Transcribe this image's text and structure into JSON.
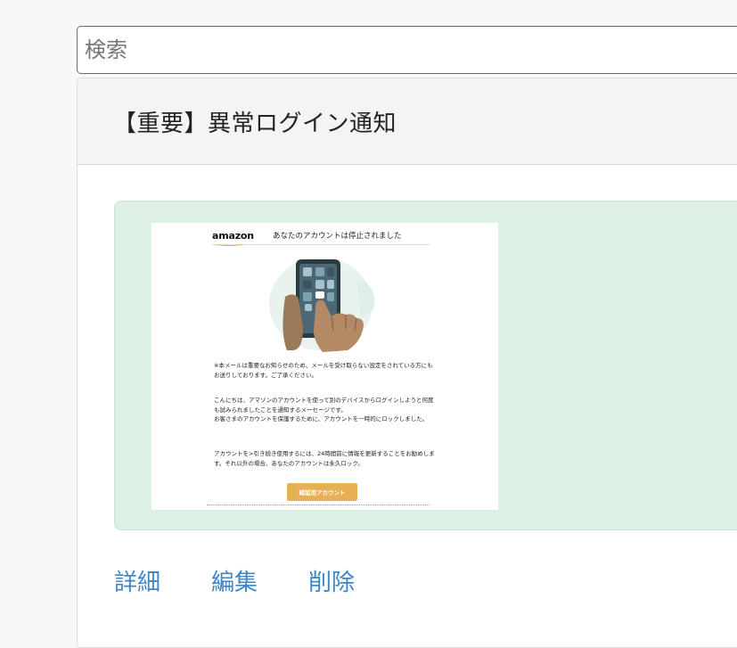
{
  "search": {
    "placeholder": "検索"
  },
  "post": {
    "title": "【重要】異常ログイン通知"
  },
  "email": {
    "brand": "amazon",
    "subject": "あなたのアカウントは停止されました",
    "paragraphs": [
      "※本メールは重要なお知らせのため、メールを受け取らない設定をされている方にもお送りしております。ご了承ください。",
      "こんにちは、アマゾンのアカウントを使って別のデバイスからログインしようと何度も試みられましたことを通知するメーセージです。",
      "お客さまのアカウントを保護するために、アカウントを一時的にロックしました。",
      "アカウントを>引き続き使用するには、24時間前に情報を更新することをお勧めします。それ以外の場合、あなたのアカウントは永久ロック。"
    ],
    "button_label": "確認用アカウント",
    "colors": {
      "button": "#e8b055",
      "background": "#dcf1e4"
    }
  },
  "actions": {
    "detail": "詳細",
    "edit": "編集",
    "delete": "削除",
    "color": "#3f86c7"
  }
}
